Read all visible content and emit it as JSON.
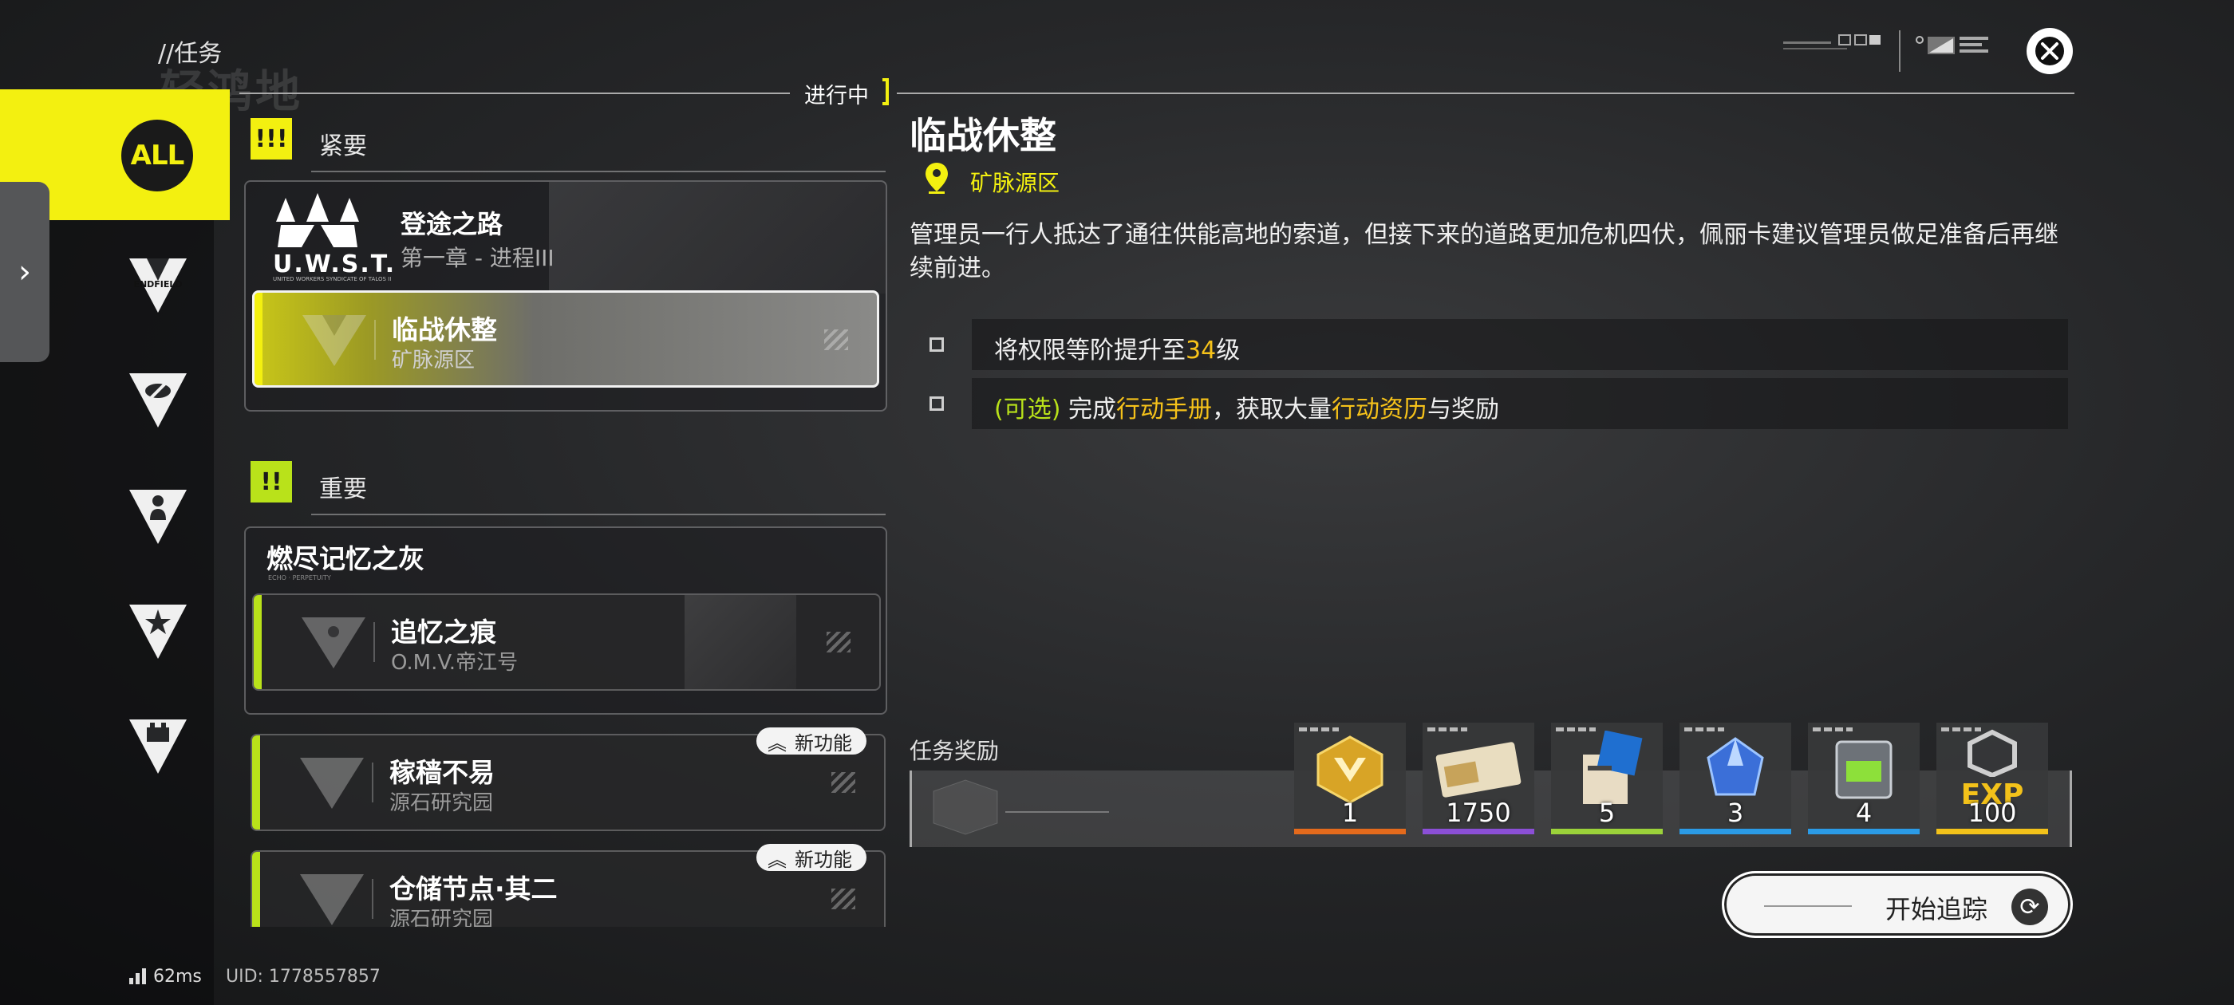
{
  "header": {
    "title": "//任务",
    "deco": "轻鸿地"
  },
  "status": {
    "label": "进行中"
  },
  "rail": {
    "all_label": "ALL",
    "categories": [
      {
        "name": "endfield",
        "text": "ENDFIELD"
      },
      {
        "name": "eye"
      },
      {
        "name": "person"
      },
      {
        "name": "star"
      },
      {
        "name": "building"
      }
    ]
  },
  "sections": {
    "urgent": {
      "badge": "!!!",
      "label": "紧要"
    },
    "important": {
      "badge": "!!",
      "label": "重要"
    }
  },
  "urgent_group": {
    "title": "登途之路",
    "subtitle": "第一章 - 进程III",
    "logo_text": "U.W.S.T.",
    "logo_small": "UNITED WORKERS SYNDICATE OF TALOS II"
  },
  "quests": {
    "active": {
      "name": "临战休整",
      "sub": "矿脉源区"
    },
    "group2_title": "燃尽记忆之灰",
    "group2_small": "ECHO · PERPETUITY",
    "memory": {
      "name": "追忆之痕",
      "sub": "O.M.V.帝江号"
    },
    "q3": {
      "name": "稼穑不易",
      "sub": "源石研究园",
      "tag": "新功能"
    },
    "q4": {
      "name": "仓储节点·其二",
      "sub": "源石研究园",
      "tag": "新功能"
    }
  },
  "detail": {
    "title": "临战休整",
    "location": "矿脉源区",
    "description": "管理员一行人抵达了通往供能高地的索道，但接下来的道路更加危机四伏，佩丽卡建议管理员做足准备后再继续前进。",
    "objectives": [
      {
        "pre": "将权限等阶提升至",
        "num": "34",
        "post": "级"
      },
      {
        "opt": "(可选)",
        "t1": " 完成",
        "h1": "行动手册",
        "t2": "，获取大量",
        "h2": "行动资历",
        "t3": "与奖励"
      }
    ]
  },
  "rewards": {
    "label": "任务奖励",
    "items": [
      {
        "name": "gold-crest",
        "count": "1",
        "bar": "#e46a1c"
      },
      {
        "name": "ticket",
        "count": "1750",
        "bar": "#8b4fd6"
      },
      {
        "name": "exp-card",
        "count": "5",
        "bar": "#9bd23a"
      },
      {
        "name": "crystal",
        "count": "3",
        "bar": "#2b9be6"
      },
      {
        "name": "device",
        "count": "4",
        "bar": "#2b9be6"
      },
      {
        "name": "exp",
        "count": "100",
        "bar": "#f3c21a",
        "text": "EXP"
      }
    ]
  },
  "track_button": {
    "label": "开始追踪"
  },
  "footer": {
    "ping": "62ms",
    "uid": "UID: 1778557857"
  }
}
